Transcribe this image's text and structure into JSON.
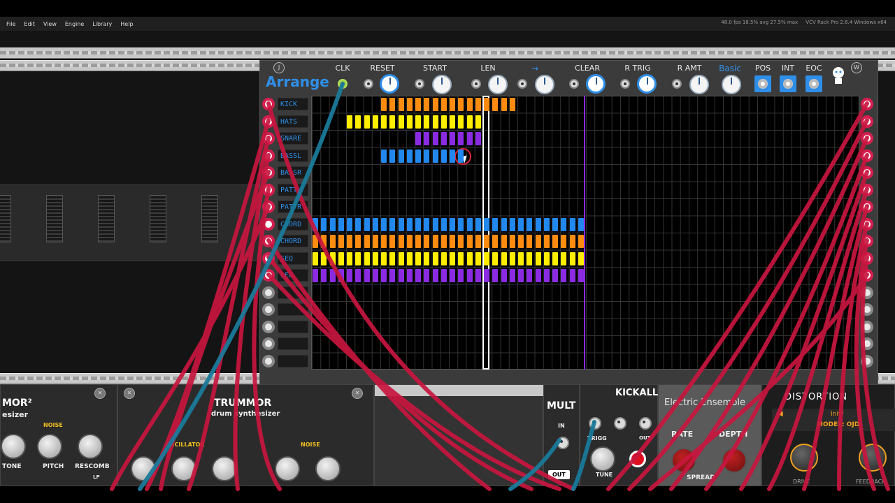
{
  "menu": {
    "items": [
      "File",
      "Edit",
      "View",
      "Engine",
      "Library",
      "Help"
    ],
    "perf": "48.0 fps   18.5% avg   27.5% max",
    "version": "VCV Rack Pro 2.6.4 Windows x64"
  },
  "arrange": {
    "title": "Arrange",
    "badge_left": "J",
    "badge_right": "W",
    "controls": [
      {
        "label": "CLK",
        "kind": "jack-green"
      },
      {
        "label": "RESET",
        "kind": "jack-knob"
      },
      {
        "label": "START",
        "kind": "jack-knob"
      },
      {
        "label": "LEN",
        "kind": "jack-knob"
      },
      {
        "label": "→",
        "kind": "jack-knob",
        "blue": true
      },
      {
        "label": "CLEAR",
        "kind": "jack-knob"
      },
      {
        "label": "R TRIG",
        "kind": "jack-knob"
      },
      {
        "label": "R AMT",
        "kind": "jack-knob"
      },
      {
        "label": "Basic",
        "kind": "knob",
        "blue": true
      },
      {
        "label": "POS",
        "kind": "button"
      },
      {
        "label": "INT",
        "kind": "button"
      },
      {
        "label": "EOC",
        "kind": "button"
      }
    ],
    "tracks": [
      "KICK",
      "HATS",
      "SNARE",
      "BASSL",
      "BASSR",
      "PATTL",
      "PATTR",
      "CHORD",
      "CHORD",
      "SEQ",
      "SEQ",
      "",
      "",
      "",
      "",
      ""
    ],
    "colors": {
      "orange": "#ff8c10",
      "yellow": "#ffee00",
      "purple": "#8a2be2",
      "blue": "#2288ee",
      "jack_red": "#d61e4e",
      "title_blue": "#2f8fe8"
    }
  },
  "bottom": {
    "mod1": {
      "title_partial": "MOR²",
      "subtitle_partial": "esizer",
      "noise": "NOISE",
      "tone": "TONE",
      "pitch": "PITCH",
      "rescomb": "RESCOMB",
      "lp": "LP"
    },
    "mod2": {
      "title": "TRUMMOR",
      "subtitle": "drum synthesizer",
      "oscillator": "OSCILLATOR",
      "noise": "NOISE"
    },
    "mult": {
      "title": "MULT",
      "in": "IN",
      "out": "OUT"
    },
    "kickall": {
      "title": "KICKALL",
      "trigg": "TRIGG",
      "out": "OUT",
      "tune": "TUNE"
    },
    "electric": {
      "title": "Electric Ensemble",
      "rate": "RATE",
      "depth": "DEPTH",
      "spread": "SPREAD"
    },
    "distortion": {
      "title": "DISTORTION",
      "preset": "Init*",
      "model": "MODEL: OJD",
      "drive": "DRIVE",
      "feedback": "FEEDBACK"
    }
  }
}
